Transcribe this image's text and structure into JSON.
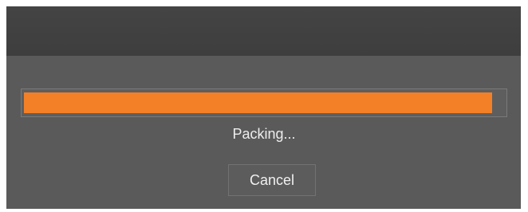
{
  "progress": {
    "fraction": 0.975,
    "fill_color": "#f37f26",
    "status_label": "Packing..."
  },
  "actions": {
    "cancel_label": "Cancel"
  }
}
